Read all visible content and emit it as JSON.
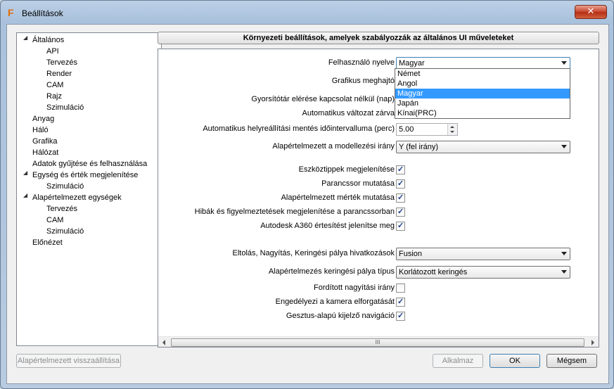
{
  "window": {
    "title": "Beállítások",
    "app_icon": "F",
    "close_glyph": "✕"
  },
  "tree": {
    "items": [
      {
        "label": "Általános",
        "level": 0,
        "expanded": true
      },
      {
        "label": "API",
        "level": 1
      },
      {
        "label": "Tervezés",
        "level": 1
      },
      {
        "label": "Render",
        "level": 1
      },
      {
        "label": "CAM",
        "level": 1
      },
      {
        "label": "Rajz",
        "level": 1
      },
      {
        "label": "Szimuláció",
        "level": 1
      },
      {
        "label": "Anyag",
        "level": 0
      },
      {
        "label": "Háló",
        "level": 0
      },
      {
        "label": "Grafika",
        "level": 0
      },
      {
        "label": "Hálózat",
        "level": 0
      },
      {
        "label": "Adatok gyűjtése és felhasználása",
        "level": 0
      },
      {
        "label": "Egység és érték megjelenítése",
        "level": 0,
        "expanded": true
      },
      {
        "label": "Szimuláció",
        "level": 1
      },
      {
        "label": "Alapértelmezett egységek",
        "level": 0,
        "expanded": true
      },
      {
        "label": "Tervezés",
        "level": 1
      },
      {
        "label": "CAM",
        "level": 1
      },
      {
        "label": "Szimuláció",
        "level": 1
      },
      {
        "label": "Előnézet",
        "level": 0
      }
    ]
  },
  "panel": {
    "header": "Környezeti beállítások, amelyek szabályozzák az általános UI műveleteket",
    "rows": {
      "language": {
        "label": "Felhasználó nyelve",
        "value": "Magyar"
      },
      "graphics_driver": {
        "label": "Grafikus meghajtó"
      },
      "offline_cache": {
        "label": "Gyorsítótár elérése kapcsolat nélkül (nap)"
      },
      "auto_version": {
        "label": "Automatikus változat zárva"
      },
      "autosave": {
        "label": "Automatikus helyreállítási mentés időintervalluma (perc)",
        "value": "5.00"
      },
      "modeling_dir": {
        "label": "Alapértelmezett a modellezési irány",
        "value": "Y (fel irány)"
      },
      "tooltips": {
        "label": "Eszköztippek megjelenítése",
        "checked": true
      },
      "command_line": {
        "label": "Parancssor mutatása",
        "checked": true
      },
      "default_scale": {
        "label": "Alapértelmezett mérték mutatása",
        "checked": true
      },
      "errors": {
        "label": "Hibák és figyelmeztetések megjelenítése a parancssorban",
        "checked": true
      },
      "a360": {
        "label": "Autodesk A360 értesítést jelenítse meg",
        "checked": true
      },
      "pan_zoom": {
        "label": "Eltolás, Nagyítás, Keringési pálya hivatkozások",
        "value": "Fusion"
      },
      "orbit_type": {
        "label": "Alapértelmezés keringési pálya típus",
        "value": "Korlátozott keringés"
      },
      "reverse_zoom": {
        "label": "Fordított nagyítási irány",
        "checked": false
      },
      "camera_pivot": {
        "label": "Engedélyezi a kamera elforgatását",
        "checked": true
      },
      "gesture_nav": {
        "label": "Gesztus-alapú kijelző navigáció",
        "checked": true
      }
    },
    "language_options": [
      "Német",
      "Angol",
      "Magyar",
      "Japán",
      "Kínai(PRC)"
    ],
    "selected_language_index": 2,
    "scroll_thumb_glyph": "III",
    "check_glyph": "✓"
  },
  "buttons": {
    "restore_defaults": "Alapértelmezett visszaállítása",
    "apply": "Alkalmaz",
    "ok": "OK",
    "cancel": "Mégsem"
  }
}
